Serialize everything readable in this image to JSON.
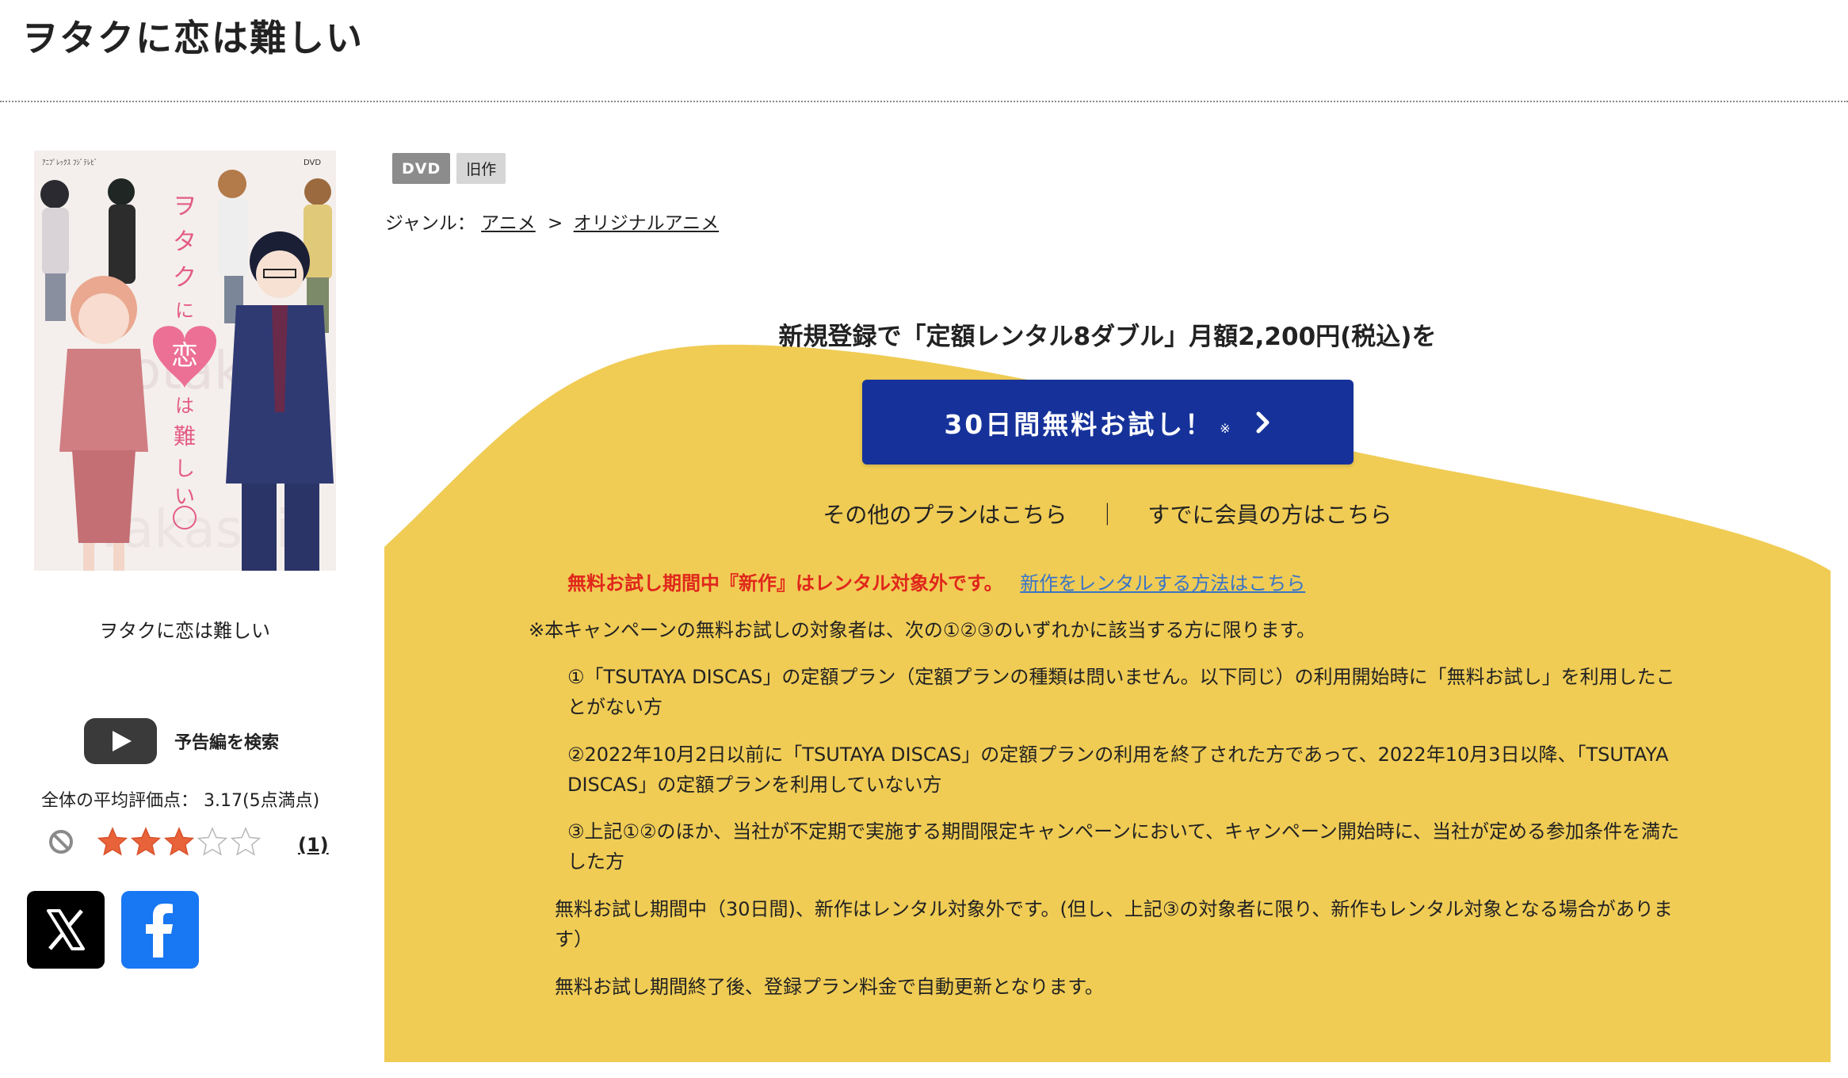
{
  "page": {
    "title": "ヲタクに恋は難しい"
  },
  "left": {
    "cover_alt": "ヲタクに恋は難しい",
    "work_title": "ヲタクに恋は難しい",
    "trailer_label": "予告編を検索",
    "avg_rating_label": "全体の平均評価点：",
    "avg_rating_value": "3.17(5点満点)",
    "rating_stars": 3,
    "rating_max": 5,
    "review_count": "(1)"
  },
  "badges": [
    "DVD",
    "旧作"
  ],
  "genre": {
    "label": "ジャンル：",
    "items": [
      "アニメ",
      "オリジナルアニメ"
    ],
    "separator": ">"
  },
  "promo": {
    "headline": "新規登録で「定額レンタル8ダブル」月額2,200円(税込)を",
    "cta_label": "30日間無料お試し！",
    "cta_mark": "※",
    "other_plans": "その他のプランはこちら",
    "member_link": "すでに会員の方はこちら",
    "link_separator": "｜",
    "accent_color": "#f0cc55",
    "cta_color": "#16329a"
  },
  "notes": {
    "red_text": "無料お試し期間中『新作』はレンタル対象外です。",
    "red_link": "新作をレンタルする方法はこちら",
    "eligibility": "※本キャンペーンの無料お試しの対象者は、次の①②③のいずれかに該当する方に限ります。",
    "item1": "①「TSUTAYA DISCAS」の定額プラン（定額プランの種類は問いません。以下同じ）の利用開始時に「無料お試し」を利用したことがない方",
    "item2": "②2022年10月2日以前に「TSUTAYA DISCAS」の定額プランの利用を終了された方であって、2022年10月3日以降、「TSUTAYA DISCAS」の定額プランを利用していない方",
    "item3": "③上記①②のほか、当社が不定期で実施する期間限定キャンペーンにおいて、キャンペーン開始時に、当社が定める参加条件を満たした方",
    "trial_note": "無料お試し期間中（30日間)、新作はレンタル対象外です。(但し、上記③の対象者に限り、新作もレンタル対象となる場合があります）",
    "renewal_note": "無料お試し期間終了後、登録プラン料金で自動更新となります。"
  }
}
